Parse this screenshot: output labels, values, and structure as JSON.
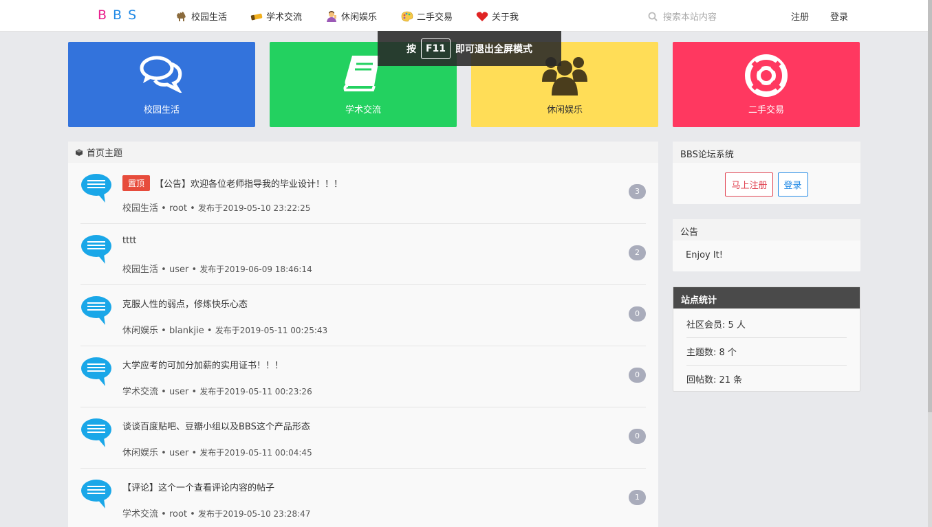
{
  "brand": {
    "logo_letters": [
      "B",
      "B",
      "S"
    ],
    "logo_colors": [
      "#e91e8c",
      "#1e88e5",
      "#1e88e5"
    ]
  },
  "nav": {
    "items": [
      {
        "label": "校园生活",
        "icon": "camel-icon"
      },
      {
        "label": "学术交流",
        "icon": "chalk-icon"
      },
      {
        "label": "休闲娱乐",
        "icon": "person-icon"
      },
      {
        "label": "二手交易",
        "icon": "palette-icon"
      },
      {
        "label": "关于我",
        "icon": "heart-icon"
      }
    ],
    "search_placeholder": "搜索本站内容",
    "register": "注册",
    "login": "登录"
  },
  "toast": {
    "prefix": "按",
    "key": "F11",
    "suffix": "即可退出全屏模式"
  },
  "tiles": [
    {
      "label": "校园生活",
      "color": "#3373dc",
      "icon": "chat-bubbles-icon"
    },
    {
      "label": "学术交流",
      "color": "#23d160",
      "icon": "book-icon"
    },
    {
      "label": "休闲娱乐",
      "color": "#ffdd57",
      "icon": "users-icon"
    },
    {
      "label": "二手交易",
      "color": "#ff3860",
      "icon": "life-ring-icon"
    }
  ],
  "main": {
    "header": "首页主题",
    "pin_label": "置顶",
    "topics": [
      {
        "title": "【公告】欢迎各位老师指导我的毕业设计！！！",
        "category": "校园生活",
        "author": "root",
        "time": "发布于2019-05-10 23:22:25",
        "replies": "3",
        "pinned": true
      },
      {
        "title": "tttt",
        "category": "校园生活",
        "author": "user",
        "time": "发布于2019-06-09 18:46:14",
        "replies": "2",
        "pinned": false
      },
      {
        "title": "克服人性的弱点，修炼快乐心态",
        "category": "休闲娱乐",
        "author": "blankjie",
        "time": "发布于2019-05-11 00:25:43",
        "replies": "0",
        "pinned": false
      },
      {
        "title": "大学应考的可加分加薪的实用证书！！！",
        "category": "学术交流",
        "author": "user",
        "time": "发布于2019-05-11 00:23:26",
        "replies": "0",
        "pinned": false
      },
      {
        "title": "谈谈百度贴吧、豆瓣小组以及BBS这个产品形态",
        "category": "休闲娱乐",
        "author": "user",
        "time": "发布于2019-05-11 00:04:45",
        "replies": "0",
        "pinned": false
      },
      {
        "title": "【评论】这个一个查看评论内容的帖子",
        "category": "学术交流",
        "author": "root",
        "time": "发布于2019-05-10 23:28:47",
        "replies": "1",
        "pinned": false
      }
    ]
  },
  "sidebar": {
    "site": {
      "title": "BBS论坛系统",
      "register_btn": "马上注册",
      "login_btn": "登录"
    },
    "notice": {
      "title": "公告",
      "text": "Enjoy It!"
    },
    "stats": {
      "title": "站点统计",
      "rows": [
        "社区会员: 5 人",
        "主题数: 8 个",
        "回帖数: 21 条"
      ]
    }
  },
  "colors": {
    "accent_blue": "#1e88e5",
    "danger": "#e74c3c",
    "badge": "#a9acbb",
    "stats_head": "#4a4a4a"
  }
}
